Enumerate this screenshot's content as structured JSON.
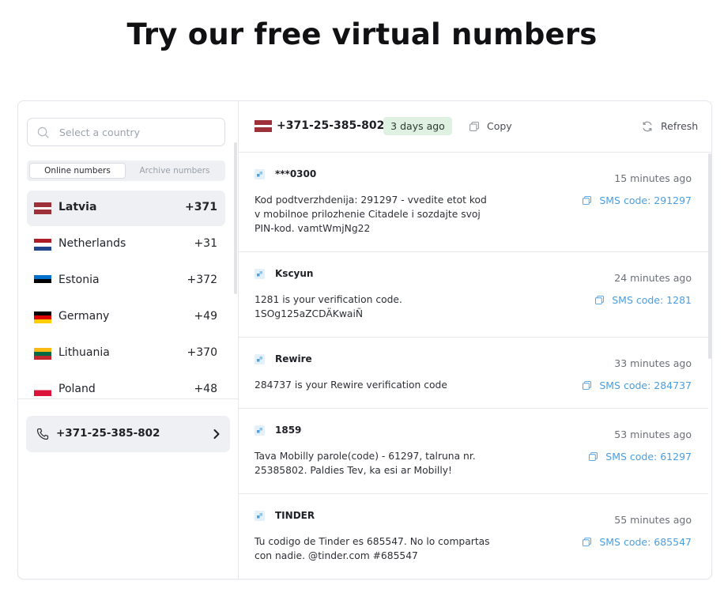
{
  "page": {
    "title": "Try our free virtual numbers"
  },
  "sidebar": {
    "search_placeholder": "Select a country",
    "tabs": {
      "online": "Online numbers",
      "archive": "Archive numbers"
    },
    "countries": [
      {
        "name": "Latvia",
        "code": "+371",
        "flag": "latvia-flag"
      },
      {
        "name": "Netherlands",
        "code": "+31",
        "flag": "netherlands-flag"
      },
      {
        "name": "Estonia",
        "code": "+372",
        "flag": "estonia-flag"
      },
      {
        "name": "Germany",
        "code": "+49",
        "flag": "germany-flag"
      },
      {
        "name": "Lithuania",
        "code": "+370",
        "flag": "lithuania-flag"
      },
      {
        "name": "Poland",
        "code": "+48",
        "flag": "poland-flag"
      }
    ],
    "selected_number": "+371-25-385-802"
  },
  "header": {
    "number": "+371-25-385-802",
    "age_badge": "3 days ago",
    "copy_label": "Copy",
    "refresh_label": "Refresh"
  },
  "messages": [
    {
      "sender": "***0300",
      "time": "15 minutes ago",
      "body": "Kod podtverzhdenija: 291297 - vvedite etot kod v mobilnoe prilozhenie Citadele i sozdajte svoj PIN-kod. vamtWmjNg22",
      "code_label": "SMS code: 291297"
    },
    {
      "sender": "Kscyun",
      "time": "24 minutes ago",
      "body": "1281 is your verification code. 1SOg125aZCDÄKwaiÑ",
      "code_label": "SMS code: 1281"
    },
    {
      "sender": "Rewire",
      "time": "33 minutes ago",
      "body": "284737 is your Rewire verification code",
      "code_label": "SMS code: 284737"
    },
    {
      "sender": "1859",
      "time": "53 minutes ago",
      "body": "Tava Mobilly parole(code) - 61297, talruna nr. 25385802. Paldies Tev, ka esi ar Mobilly!",
      "code_label": "SMS code: 61297"
    },
    {
      "sender": "TINDER",
      "time": "55 minutes ago",
      "body": "Tu codigo de Tinder es 685547. No lo compartas con nadie. @tinder.com #685547",
      "code_label": "SMS code: 685547"
    }
  ],
  "colors": {
    "accent": "#4a9ee0",
    "badge_bg": "#dff2e1",
    "selected_bg": "#eef0f3"
  }
}
